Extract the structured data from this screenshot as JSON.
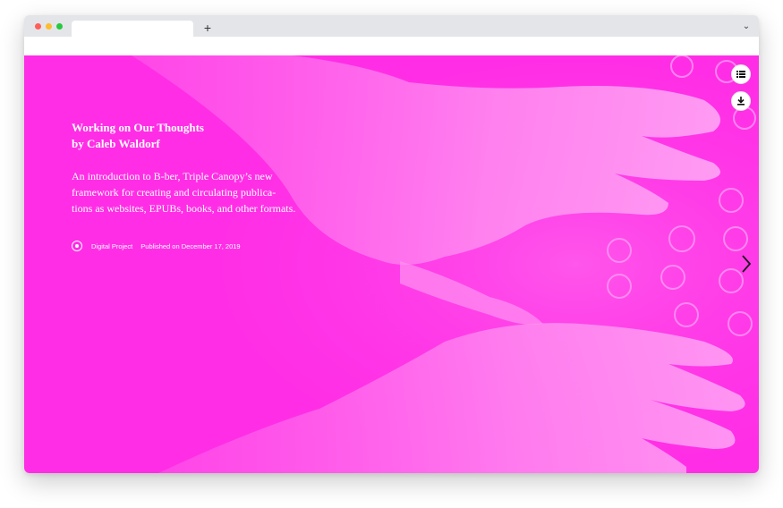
{
  "browser": {
    "tab_title": "",
    "new_tab_label": "+",
    "tab_menu_label": "⌄",
    "traffic_colors": {
      "close": "#ff5f57",
      "minimize": "#febc2e",
      "maximize": "#28c840"
    }
  },
  "hero": {
    "background_color": "#ff2de6",
    "title_line1": "Working on Our Thoughts",
    "title_line2": "by Caleb Waldorf",
    "desc_lines": [
      "An introduction to B-ber, Triple Canopy’s new",
      "framework for creating and circulating publica-",
      "tions as websites, EPUBs, books, and other formats."
    ],
    "category": "Digital Project",
    "published": "Published on December 17, 2019"
  },
  "actions": {
    "menu_icon": "list-icon",
    "download_icon": "download-icon",
    "next_icon": "chevron-right-icon"
  }
}
